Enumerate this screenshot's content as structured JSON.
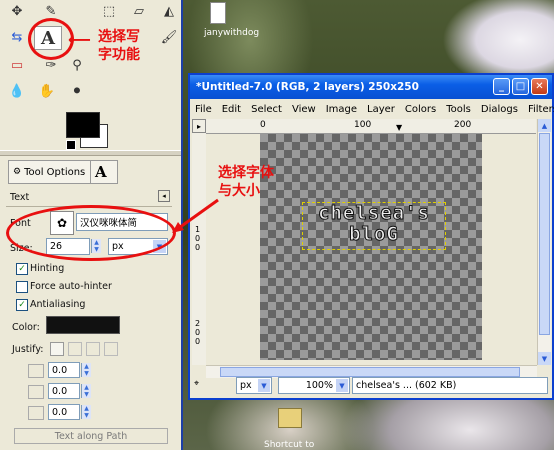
{
  "desktop": {
    "icon_top_label": "janywithdog",
    "icon_bottom_label": "Shortcut to"
  },
  "toolbox": {
    "tab_label": "Tool Options",
    "section_title": "Text",
    "font_label": "Font",
    "font_value": "汉仪咪咪体简",
    "size_label": "Size:",
    "size_value": "26",
    "unit_value": "px",
    "hinting_label": "Hinting",
    "hinting_checked": true,
    "autohint_label": "Force auto-hinter",
    "autohint_checked": false,
    "antialias_label": "Antialiasing",
    "antialias_checked": true,
    "color_label": "Color:",
    "justify_label": "Justify:",
    "spin1": "0.0",
    "spin2": "0.0",
    "spin3": "0.0",
    "text_along_path": "Text along Path"
  },
  "annotations": {
    "select_text_tool": "选择写\n字功能",
    "select_font_size": "选择字体\n与大小"
  },
  "window": {
    "title": "*Untitled-7.0 (RGB, 2 layers) 250x250",
    "menus": [
      "File",
      "Edit",
      "Select",
      "View",
      "Image",
      "Layer",
      "Colors",
      "Tools",
      "Dialogs",
      "Filters"
    ],
    "ruler_h": [
      "0",
      "100",
      "200"
    ],
    "ruler_v": [
      "1",
      "0",
      "0",
      "2",
      "0",
      "0"
    ],
    "canvas_text": "chelsea's\nbloG",
    "status_unit": "px",
    "status_zoom": "100%",
    "status_text": "chelsea's ... (602 KB)"
  },
  "colors": {
    "annotation_red": "#e81010",
    "titlebar_blue": "#0a5ee6",
    "toolbox_bg": "#ece9d8"
  }
}
